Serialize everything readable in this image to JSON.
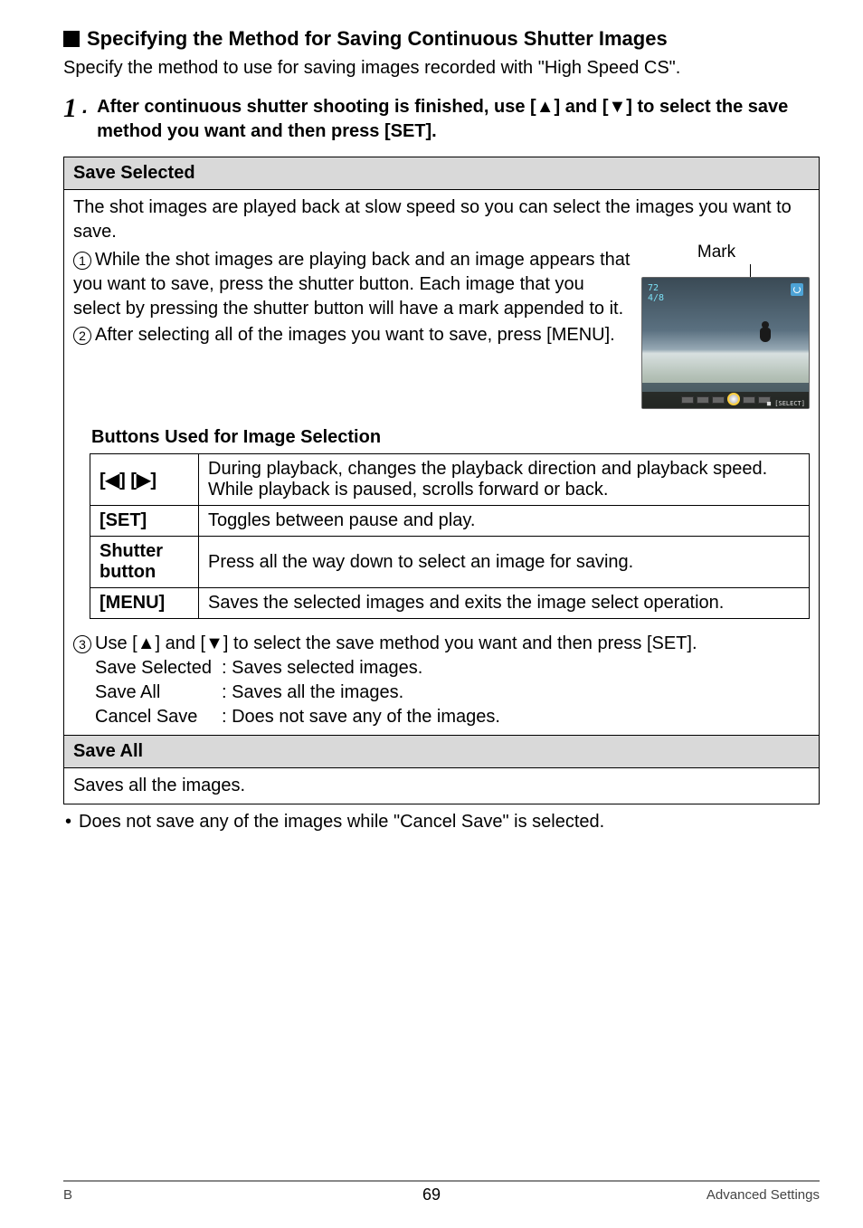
{
  "heading": {
    "title": "Specifying the Method for Saving Continuous Shutter Images",
    "intro": "Specify the method to use for saving images recorded with \"High Speed CS\"."
  },
  "step1": {
    "prefix_num": "1",
    "prefix_dot": ".",
    "text_a": "After continuous shutter shooting is finished, use [",
    "arrow_up": "▲",
    "text_b": "] and [",
    "arrow_down": "▼",
    "text_c": "] to select the save method you want and then press [SET]."
  },
  "save_selected": {
    "header": "Save Selected",
    "intro": "The shot images are played back at slow speed so you can select the images you want to save.",
    "mark_label": "Mark",
    "thumb_nums": "72\n4/8",
    "item1": "While the shot images are playing back and an image appears that you want to save, press the shutter button. Each image that you select by pressing the shutter button will have a mark appended to it.",
    "item2": "After selecting all of the images you want to save, press [MENU].",
    "buttons_heading": "Buttons Used for Image Selection",
    "btn_table": {
      "r1_label_a": "[",
      "r1_arrow_l": "◀",
      "r1_label_b": "] [",
      "r1_arrow_r": "▶",
      "r1_label_c": "]",
      "r1_desc": "During playback, changes the playback direction and playback speed.\nWhile playback is paused, scrolls forward or back.",
      "r2_label": "[SET]",
      "r2_desc": "Toggles between pause and play.",
      "r3_label": "Shutter button",
      "r3_desc": "Press all the way down to select an image for saving.",
      "r4_label": "[MENU]",
      "r4_desc": "Saves the selected images and exits the image select operation."
    },
    "item3_a": "Use [",
    "item3_arrow_up": "▲",
    "item3_b": "] and [",
    "item3_arrow_down": "▼",
    "item3_c": "] to select the save method you want and then press [SET].",
    "sub1_label": "Save Selected",
    "sub1_desc": ": Saves selected images.",
    "sub2_label": "Save All",
    "sub2_desc": ": Saves all the images.",
    "sub3_label": "Cancel Save",
    "sub3_desc": ": Does not save any of the images."
  },
  "save_all": {
    "header": "Save All",
    "desc": "Saves all the images."
  },
  "note": "Does not save any of the images while \"Cancel Save\" is selected.",
  "footer": {
    "left": "B",
    "center": "69",
    "right": "Advanced Settings"
  }
}
